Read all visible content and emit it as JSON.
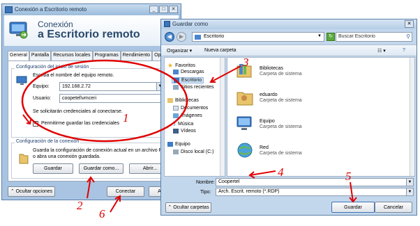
{
  "rdp": {
    "title": "Conexión a Escritorio remoto",
    "header_line1": "Conexión",
    "header_line2": "a Escritorio remoto",
    "tabs": [
      "General",
      "Pantalla",
      "Recursos locales",
      "Programas",
      "Rendimiento",
      "Opcio"
    ],
    "login_group_title": "Configuración del inicio de sesión",
    "login_prompt": "Escriba el nombre del equipo remoto.",
    "computer_label": "Equipo:",
    "computer_value": "192.168.2.72",
    "user_label": "Usuario:",
    "user_value": "coopetel\\vmceri",
    "credentials_note": "Se solicitarán credenciales al conectarse.",
    "save_credentials_label": "Permitirme guardar las credenciales",
    "save_credentials_checked": true,
    "conn_group_title": "Configuración de la conexión",
    "conn_desc": "Guarda la configuración de conexión actual en un archivo RDP o abra una conexión guardada.",
    "save_button": "Guardar",
    "save_as_button": "Guardar como...",
    "open_button": "Abrir...",
    "hide_options": "Ocultar opciones",
    "connect_button": "Conectar",
    "help_button": "Ayuda"
  },
  "save_dialog": {
    "title": "Guardar como",
    "path": "Escritorio",
    "search_placeholder": "Buscar Escritorio",
    "organize": "Organizar",
    "new_folder": "Nueva carpeta",
    "nav": {
      "favorites_head": "Favoritos",
      "favorites": [
        "Descargas",
        "Escritorio",
        "Sitios recientes"
      ],
      "libraries_head": "Bibliotecas",
      "libraries": [
        "Documentos",
        "Imágenes",
        "Música",
        "Vídeos"
      ],
      "computer_head": "Equipo",
      "computer": [
        "Disco local (C:)"
      ]
    },
    "items": [
      {
        "name": "Bibliotecas",
        "desc": "Carpeta de sistema",
        "icon": "libraries-icon"
      },
      {
        "name": "eduardo",
        "desc": "Carpeta de sistema",
        "icon": "user-folder-icon"
      },
      {
        "name": "Equipo",
        "desc": "Carpeta de sistema",
        "icon": "computer-icon"
      },
      {
        "name": "Red",
        "desc": "Carpeta de sistema",
        "icon": "network-icon"
      }
    ],
    "filename_label": "Nombre:",
    "filename_value": "Coopertel",
    "type_label": "Tipo:",
    "type_value": "Arch. Escrit. remoto (*.RDP)",
    "hide_folders": "Ocultar carpetas",
    "save_button": "Guardar",
    "cancel_button": "Cancelar"
  },
  "annotations": [
    "1",
    "2",
    "3",
    "4",
    "5",
    "6"
  ],
  "colors": {
    "annotation": "#e00000",
    "accent": "#2a4a6c"
  }
}
